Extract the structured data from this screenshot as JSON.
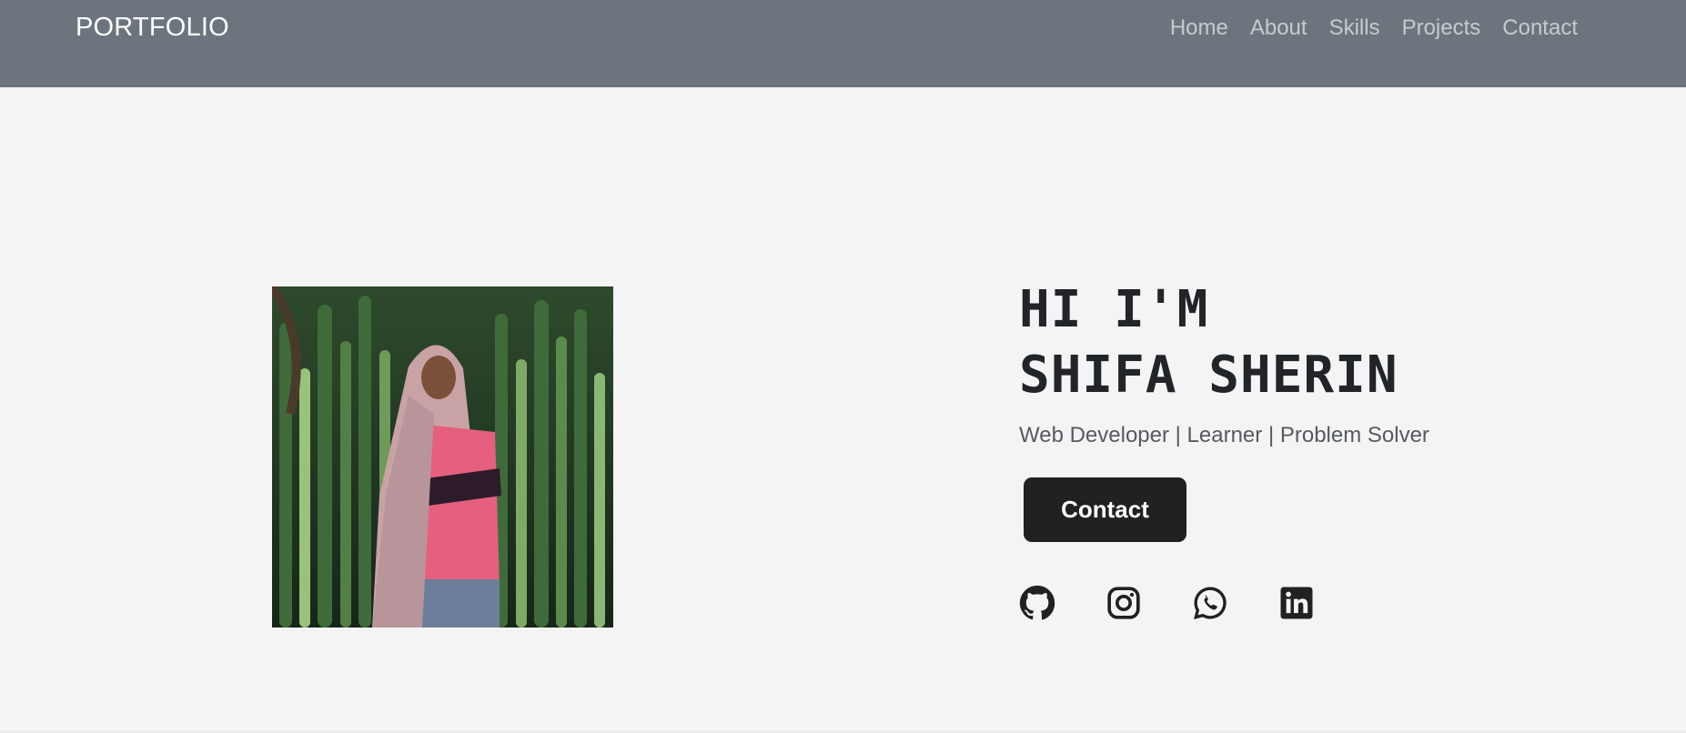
{
  "navbar": {
    "brand": "PORTFOLIO",
    "links": [
      {
        "label": "Home"
      },
      {
        "label": "About"
      },
      {
        "label": "Skills"
      },
      {
        "label": "Projects"
      },
      {
        "label": "Contact"
      }
    ]
  },
  "hero": {
    "photo": {
      "icon": "profile-photo"
    },
    "greeting_line1": "HI I'M",
    "greeting_line2": "SHIFA SHERIN",
    "tagline": "Web Developer | Learner | Problem Solver",
    "contact_button": "Contact",
    "socials": [
      {
        "icon": "github-icon"
      },
      {
        "icon": "instagram-icon"
      },
      {
        "icon": "whatsapp-icon"
      },
      {
        "icon": "linkedin-icon"
      }
    ]
  },
  "colors": {
    "navbar_bg": "#6c757d",
    "page_bg": "#f4f4f4",
    "heading": "#212529",
    "button_bg": "#212121"
  }
}
